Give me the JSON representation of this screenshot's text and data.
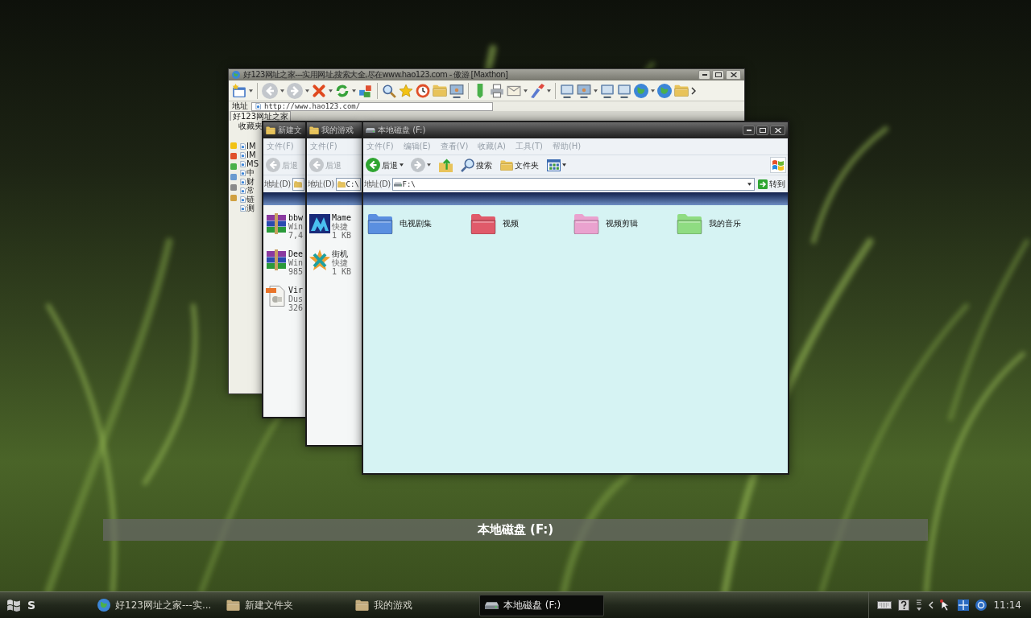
{
  "browser_window": {
    "title": "好123网址之家---实用网址,搜索大全,尽在www.hao123.com - 傲游 [Maxthon]",
    "address_label": "地址",
    "address": "http://www.hao123.com/",
    "tab": "好123网址之家",
    "favorites": {
      "title": "收藏夹",
      "items": [
        "IM",
        "IM",
        "MS",
        "中",
        "财",
        "常",
        "链",
        "测"
      ]
    }
  },
  "explorer_windows": [
    {
      "kind": "folder",
      "title": "新建文",
      "menu": [
        "文件(F)"
      ],
      "toolbar": [
        {
          "kind": "back",
          "label": "后退",
          "disabled": true
        }
      ],
      "address_label": "地址(D)",
      "items": [
        {
          "kind": "archive",
          "lines": [
            "bbw",
            "Win",
            "7,4"
          ]
        },
        {
          "kind": "archive",
          "lines": [
            "Dee",
            "Win",
            "985"
          ]
        },
        {
          "kind": "image",
          "lines": [
            "Vir",
            "Dus",
            "326"
          ]
        }
      ]
    },
    {
      "kind": "folder",
      "title": "我的游戏",
      "menu": [
        "文件(F)"
      ],
      "toolbar": [
        {
          "kind": "back",
          "label": "后退",
          "disabled": true
        }
      ],
      "address_label": "地址(D)",
      "address": "C:\\",
      "items": [
        {
          "kind": "emulator",
          "lines": [
            "Mame",
            "快捷",
            "1 KB"
          ]
        },
        {
          "kind": "game",
          "lines": [
            "街机",
            "快捷",
            "1 KB"
          ]
        }
      ]
    },
    {
      "kind": "drive",
      "title": "本地磁盘 (F:)",
      "menu": [
        "文件(F)",
        "编辑(E)",
        "查看(V)",
        "收藏(A)",
        "工具(T)",
        "帮助(H)"
      ],
      "toolbar": [
        {
          "kind": "back",
          "label": "后退",
          "disabled": false
        },
        {
          "kind": "forward",
          "disabled": true
        },
        {
          "kind": "up",
          "disabled": false
        },
        {
          "kind": "search",
          "label": "搜索",
          "disabled": false
        },
        {
          "kind": "folders",
          "label": "文件夹",
          "disabled": false
        },
        {
          "kind": "views",
          "disabled": false
        }
      ],
      "address_label": "地址(D)",
      "address": "F:\\",
      "go_label": "转到",
      "items": [
        {
          "kind": "folder",
          "lines": [
            "电视剧集"
          ],
          "color": "#5a8fe0"
        },
        {
          "kind": "folder",
          "lines": [
            "视频"
          ],
          "color": "#e05a6a"
        },
        {
          "kind": "folder",
          "lines": [
            "视频剪辑"
          ],
          "color": "#eaa2cf"
        },
        {
          "kind": "folder",
          "lines": [
            "我的音乐"
          ],
          "color": "#8fdc82"
        }
      ]
    }
  ],
  "flip_caption": "本地磁盘 (F:)",
  "taskbar": {
    "start_label": "S",
    "items": [
      {
        "kind": "browser",
        "label": "好123网址之家---实...",
        "selected": false
      },
      {
        "kind": "folder",
        "label": "新建文件夹",
        "selected": false
      },
      {
        "kind": "folder",
        "label": "我的游戏",
        "selected": false
      },
      {
        "kind": "drive",
        "label": "本地磁盘 (F:)",
        "selected": true
      }
    ],
    "clock": "11:14"
  }
}
